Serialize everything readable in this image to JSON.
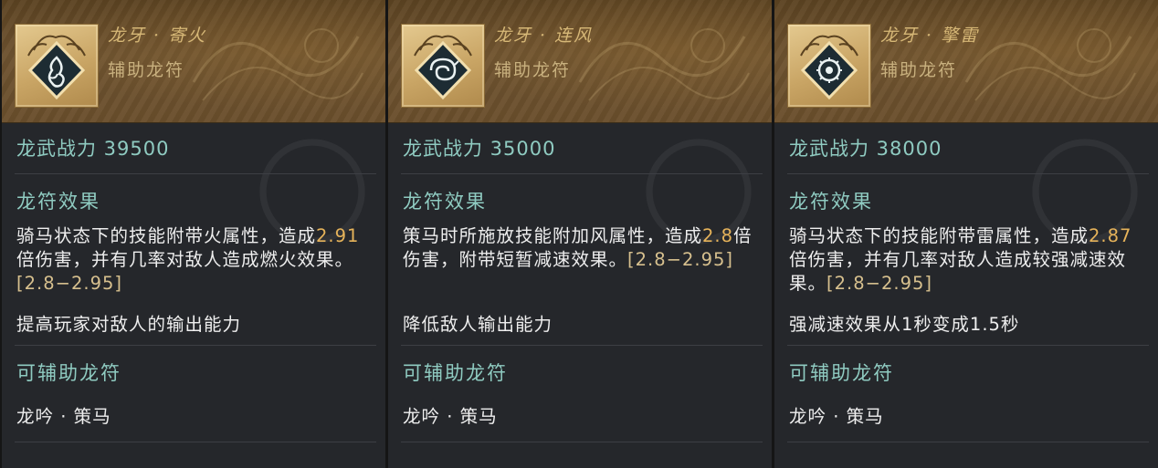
{
  "colors": {
    "accent_teal": "#8fcbc1",
    "gold_title": "#d7b877",
    "number_orange": "#e6b35a",
    "panel_bg": "#25272b",
    "header_bg": "#6e5330"
  },
  "cards": [
    {
      "name": "龙牙 · 寄火",
      "type": "辅助龙符",
      "icon": "fire-symbol-icon",
      "power": "龙武战力 39500",
      "effect_label": "龙符效果",
      "effect_prefix": "骑马状态下的技能附带火属性，造成",
      "multiplier": "2.91",
      "effect_suffix": "倍伤害，并有几率对敌人造成燃火效果。",
      "range": "[2.8−2.95]",
      "extra": "提高玩家对敌人的输出能力",
      "assist_label": "可辅助龙符",
      "assist_value": "龙吟 · 策马"
    },
    {
      "name": "龙牙 · 连风",
      "type": "辅助龙符",
      "icon": "wind-swirl-icon",
      "power": "龙武战力 35000",
      "effect_label": "龙符效果",
      "effect_prefix": "策马时所施放技能附加风属性，造成",
      "multiplier": "2.8",
      "effect_suffix": "倍伤害，附带短暂减速效果。",
      "range": "[2.8−2.95]",
      "extra": "降低敌人输出能力",
      "assist_label": "可辅助龙符",
      "assist_value": "龙吟 · 策马"
    },
    {
      "name": "龙牙 · 擎雷",
      "type": "辅助龙符",
      "icon": "thunder-drum-icon",
      "power": "龙武战力 38000",
      "effect_label": "龙符效果",
      "effect_prefix": "骑马状态下的技能附带雷属性，造成",
      "multiplier": "2.87",
      "effect_suffix": "倍伤害，并有几率对敌人造成较强减速效果。",
      "range": "[2.8−2.95]",
      "extra": "强减速效果从1秒变成1.5秒",
      "assist_label": "可辅助龙符",
      "assist_value": "龙吟 · 策马"
    }
  ]
}
